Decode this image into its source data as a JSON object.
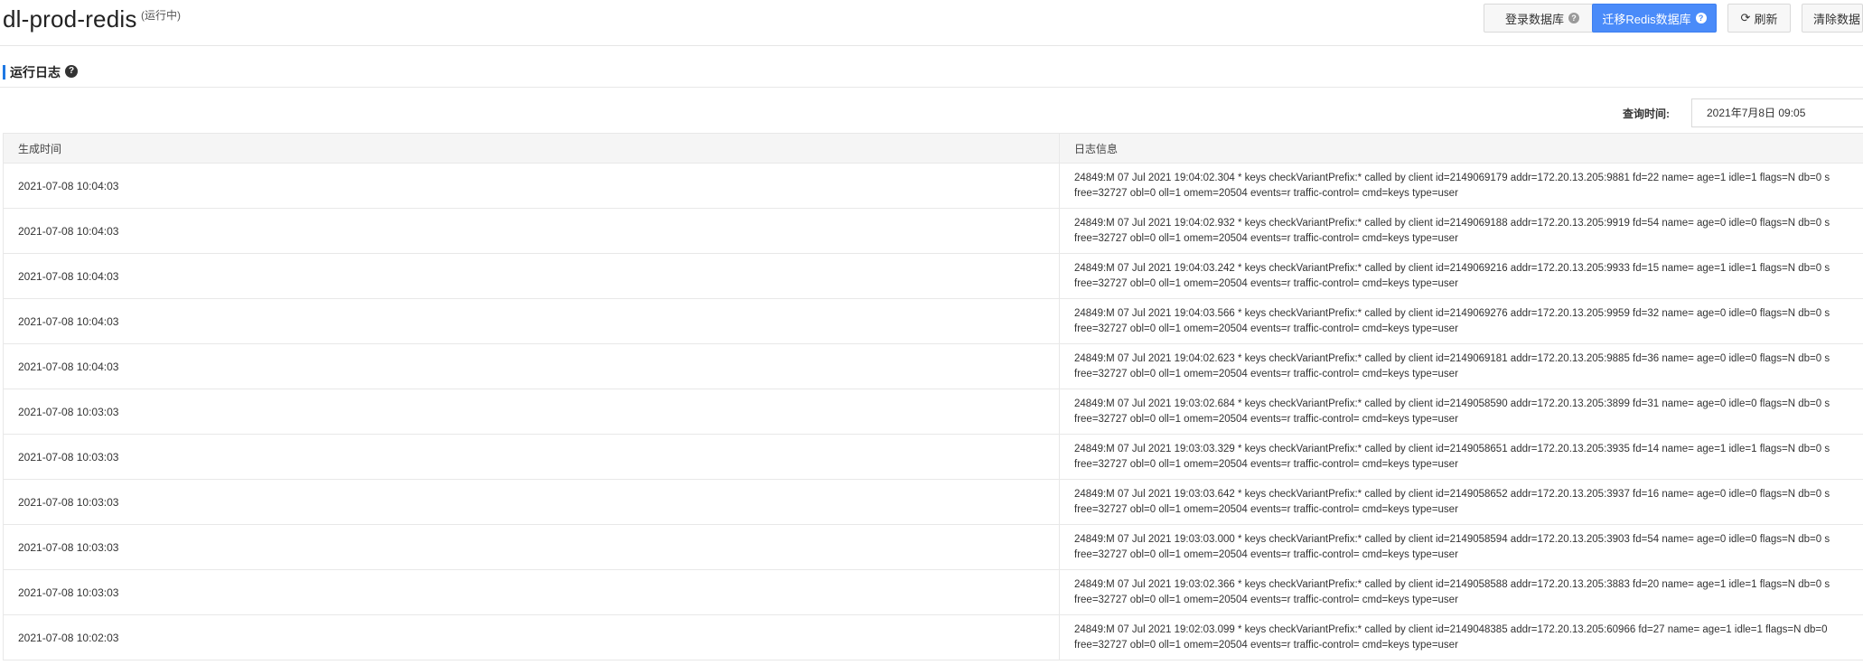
{
  "header": {
    "title": "dl-prod-redis",
    "status": "(运行中)",
    "buttons": {
      "login_db": "登录数据库",
      "migrate": "迁移Redis数据库",
      "refresh": "刷新",
      "clear": "清除数据"
    }
  },
  "section": {
    "title": "运行日志"
  },
  "query": {
    "label": "查询时间:",
    "value": "2021年7月8日 09:05"
  },
  "table": {
    "columns": [
      "生成时间",
      "日志信息"
    ],
    "rows": [
      {
        "time": "2021-07-08 10:04:03",
        "line1": "24849:M 07 Jul 2021 19:04:02.304 * keys checkVariantPrefix:* called by client id=2149069179 addr=172.20.13.205:9881 fd=22 name= age=1 idle=1 flags=N db=0 s",
        "line2": "free=32727 obl=0 oll=1 omem=20504 events=r traffic-control= cmd=keys type=user"
      },
      {
        "time": "2021-07-08 10:04:03",
        "line1": "24849:M 07 Jul 2021 19:04:02.932 * keys checkVariantPrefix:* called by client id=2149069188 addr=172.20.13.205:9919 fd=54 name= age=0 idle=0 flags=N db=0 s",
        "line2": "free=32727 obl=0 oll=1 omem=20504 events=r traffic-control= cmd=keys type=user"
      },
      {
        "time": "2021-07-08 10:04:03",
        "line1": "24849:M 07 Jul 2021 19:04:03.242 * keys checkVariantPrefix:* called by client id=2149069216 addr=172.20.13.205:9933 fd=15 name= age=1 idle=1 flags=N db=0 s",
        "line2": "free=32727 obl=0 oll=1 omem=20504 events=r traffic-control= cmd=keys type=user"
      },
      {
        "time": "2021-07-08 10:04:03",
        "line1": "24849:M 07 Jul 2021 19:04:03.566 * keys checkVariantPrefix:* called by client id=2149069276 addr=172.20.13.205:9959 fd=32 name= age=0 idle=0 flags=N db=0 s",
        "line2": "free=32727 obl=0 oll=1 omem=20504 events=r traffic-control= cmd=keys type=user"
      },
      {
        "time": "2021-07-08 10:04:03",
        "line1": "24849:M 07 Jul 2021 19:04:02.623 * keys checkVariantPrefix:* called by client id=2149069181 addr=172.20.13.205:9885 fd=36 name= age=0 idle=0 flags=N db=0 s",
        "line2": "free=32727 obl=0 oll=1 omem=20504 events=r traffic-control= cmd=keys type=user"
      },
      {
        "time": "2021-07-08 10:03:03",
        "line1": "24849:M 07 Jul 2021 19:03:02.684 * keys checkVariantPrefix:* called by client id=2149058590 addr=172.20.13.205:3899 fd=31 name= age=0 idle=0 flags=N db=0 s",
        "line2": "free=32727 obl=0 oll=1 omem=20504 events=r traffic-control= cmd=keys type=user"
      },
      {
        "time": "2021-07-08 10:03:03",
        "line1": "24849:M 07 Jul 2021 19:03:03.329 * keys checkVariantPrefix:* called by client id=2149058651 addr=172.20.13.205:3935 fd=14 name= age=1 idle=1 flags=N db=0 s",
        "line2": "free=32727 obl=0 oll=1 omem=20504 events=r traffic-control= cmd=keys type=user"
      },
      {
        "time": "2021-07-08 10:03:03",
        "line1": "24849:M 07 Jul 2021 19:03:03.642 * keys checkVariantPrefix:* called by client id=2149058652 addr=172.20.13.205:3937 fd=16 name= age=0 idle=0 flags=N db=0 s",
        "line2": "free=32727 obl=0 oll=1 omem=20504 events=r traffic-control= cmd=keys type=user"
      },
      {
        "time": "2021-07-08 10:03:03",
        "line1": "24849:M 07 Jul 2021 19:03:03.000 * keys checkVariantPrefix:* called by client id=2149058594 addr=172.20.13.205:3903 fd=54 name= age=0 idle=0 flags=N db=0 s",
        "line2": "free=32727 obl=0 oll=1 omem=20504 events=r traffic-control= cmd=keys type=user"
      },
      {
        "time": "2021-07-08 10:03:03",
        "line1": "24849:M 07 Jul 2021 19:03:02.366 * keys checkVariantPrefix:* called by client id=2149058588 addr=172.20.13.205:3883 fd=20 name= age=1 idle=1 flags=N db=0 s",
        "line2": "free=32727 obl=0 oll=1 omem=20504 events=r traffic-control= cmd=keys type=user"
      },
      {
        "time": "2021-07-08 10:02:03",
        "line1": "24849:M 07 Jul 2021 19:02:03.099 * keys checkVariantPrefix:* called by client id=2149048385 addr=172.20.13.205:60966 fd=27 name= age=1 idle=1 flags=N db=0",
        "line2": "free=32727 obl=0 oll=1 omem=20504 events=r traffic-control= cmd=keys type=user"
      }
    ]
  },
  "colors": {
    "primary": "#4a8bf9",
    "accent_bar": "#1f78e3"
  },
  "icons": {
    "help": "question-circle-icon",
    "refresh": "refresh-icon"
  }
}
